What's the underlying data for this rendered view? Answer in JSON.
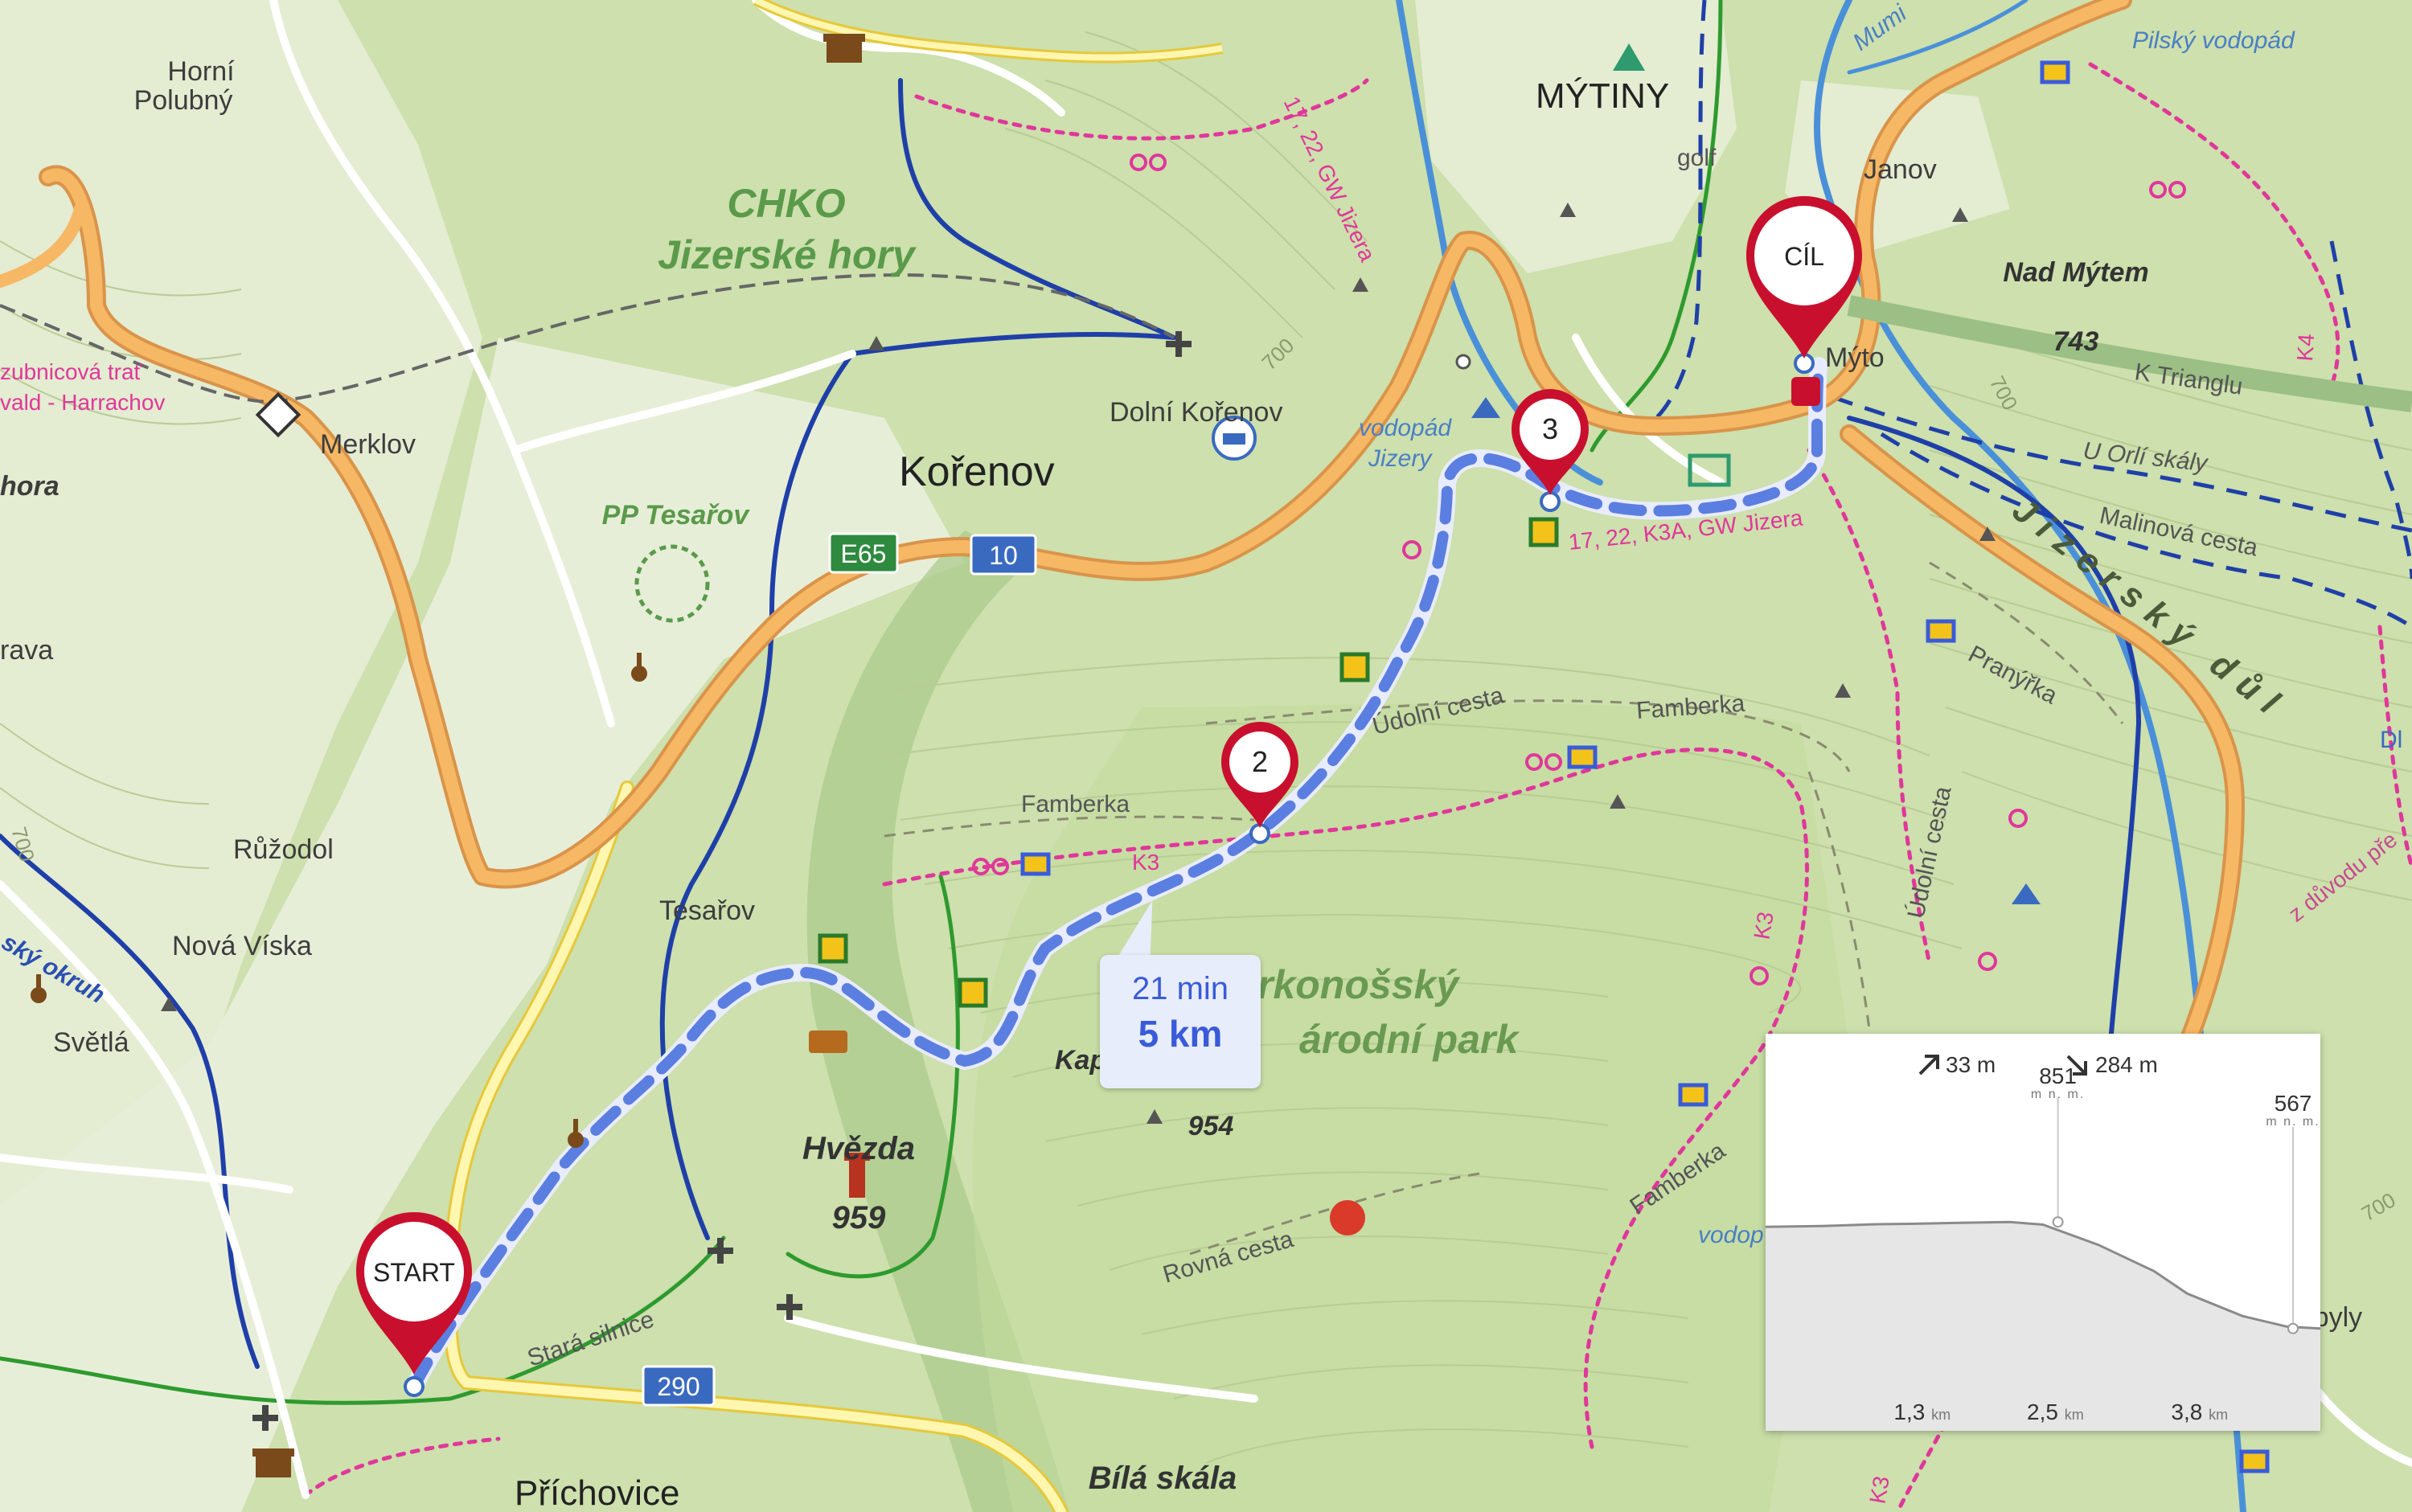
{
  "map": {
    "towns": [
      {
        "name": "Horní",
        "name2": "Polubný"
      },
      {
        "name": "MÝTINY"
      },
      {
        "name": "Kořenov"
      },
      {
        "name": "Dolní Kořenov"
      },
      {
        "name": "Merklov"
      },
      {
        "name": "Růžodol"
      },
      {
        "name": "Nová Víska"
      },
      {
        "name": "Světlá"
      },
      {
        "name": "Tesařov"
      },
      {
        "name": "Příchovice"
      },
      {
        "name": "Janov"
      },
      {
        "name": "Mýto"
      },
      {
        "name": "Zabyly"
      },
      {
        "name": "rava"
      },
      {
        "name": "hora"
      }
    ],
    "protected_area": {
      "line1": "CHKO",
      "line2": "Jizerské hory"
    },
    "national_park": {
      "line1": "rkonošský",
      "line2": "árodní park"
    },
    "peaks": [
      {
        "name": "Hvězda",
        "elev": "959"
      },
      {
        "name": "Nad Mýtem",
        "elev": "743"
      },
      {
        "name": "Kap",
        "elev": "954"
      },
      {
        "name": "Bílá skála",
        "elev": ""
      }
    ],
    "nature_labels": {
      "tesarov": "PP Tesařov",
      "ridge": "Jizerský důl"
    },
    "road_badges": {
      "e65": "E65",
      "r10": "10",
      "r290": "290"
    },
    "road_labels": [
      "Údolní cesta",
      "Famberka",
      "Famberka",
      "Famberka",
      "Stará silnice",
      "Rovná cesta",
      "Údolní cesta",
      "K Trianglu",
      "U Orlí skály",
      "Malinová cesta",
      "Pranýřka",
      "golf"
    ],
    "trail_labels": [
      "17, 22, GW Jizera",
      "17, 22, K3A, GW Jizera",
      "K3",
      "K3",
      "K4",
      "K3"
    ],
    "water_labels": [
      "vodopád",
      "Jizery",
      "Pilský vodopád",
      "vodop",
      "Mumi",
      "Dl"
    ],
    "rail_labels": {
      "line1": "zubnicová trať",
      "line2": "vald - Harrachov"
    },
    "other_labels": [
      "ský okruh",
      "z důvodu pře"
    ],
    "contours": [
      "700",
      "700",
      "700",
      "700"
    ]
  },
  "route": {
    "start_label": "START",
    "finish_label": "CÍL",
    "waypoints": [
      "2",
      "3"
    ],
    "time": "21 min",
    "distance": "5 km"
  },
  "elevation": {
    "ascent": "33 m",
    "descent": "284 m",
    "max": {
      "value": "851",
      "unit": "m n. m."
    },
    "end": {
      "value": "567",
      "unit": "m n. m."
    },
    "km_ticks": [
      {
        "value": "1,3",
        "unit": "km"
      },
      {
        "value": "2,5",
        "unit": "km"
      },
      {
        "value": "3,8",
        "unit": "km"
      }
    ],
    "profile_km": [
      0,
      1.3,
      2.5,
      3.8,
      5.0
    ],
    "profile_points": [
      [
        0,
        838
      ],
      [
        0.5,
        840
      ],
      [
        1.0,
        845
      ],
      [
        1.3,
        846
      ],
      [
        1.8,
        849
      ],
      [
        2.2,
        851
      ],
      [
        2.5,
        844
      ],
      [
        3.0,
        790
      ],
      [
        3.5,
        720
      ],
      [
        3.8,
        660
      ],
      [
        4.3,
        600
      ],
      [
        4.7,
        572
      ],
      [
        5.0,
        567
      ]
    ]
  },
  "colors": {
    "route": "#5b7fe0",
    "trail_pink": "#e0379a",
    "road_major": "#f4b560",
    "road_minor": "#fff6b0",
    "river": "#4a90d9",
    "path_blue": "#1f3fa8",
    "path_green": "#2e9a2e",
    "marker": "#c8102e"
  }
}
